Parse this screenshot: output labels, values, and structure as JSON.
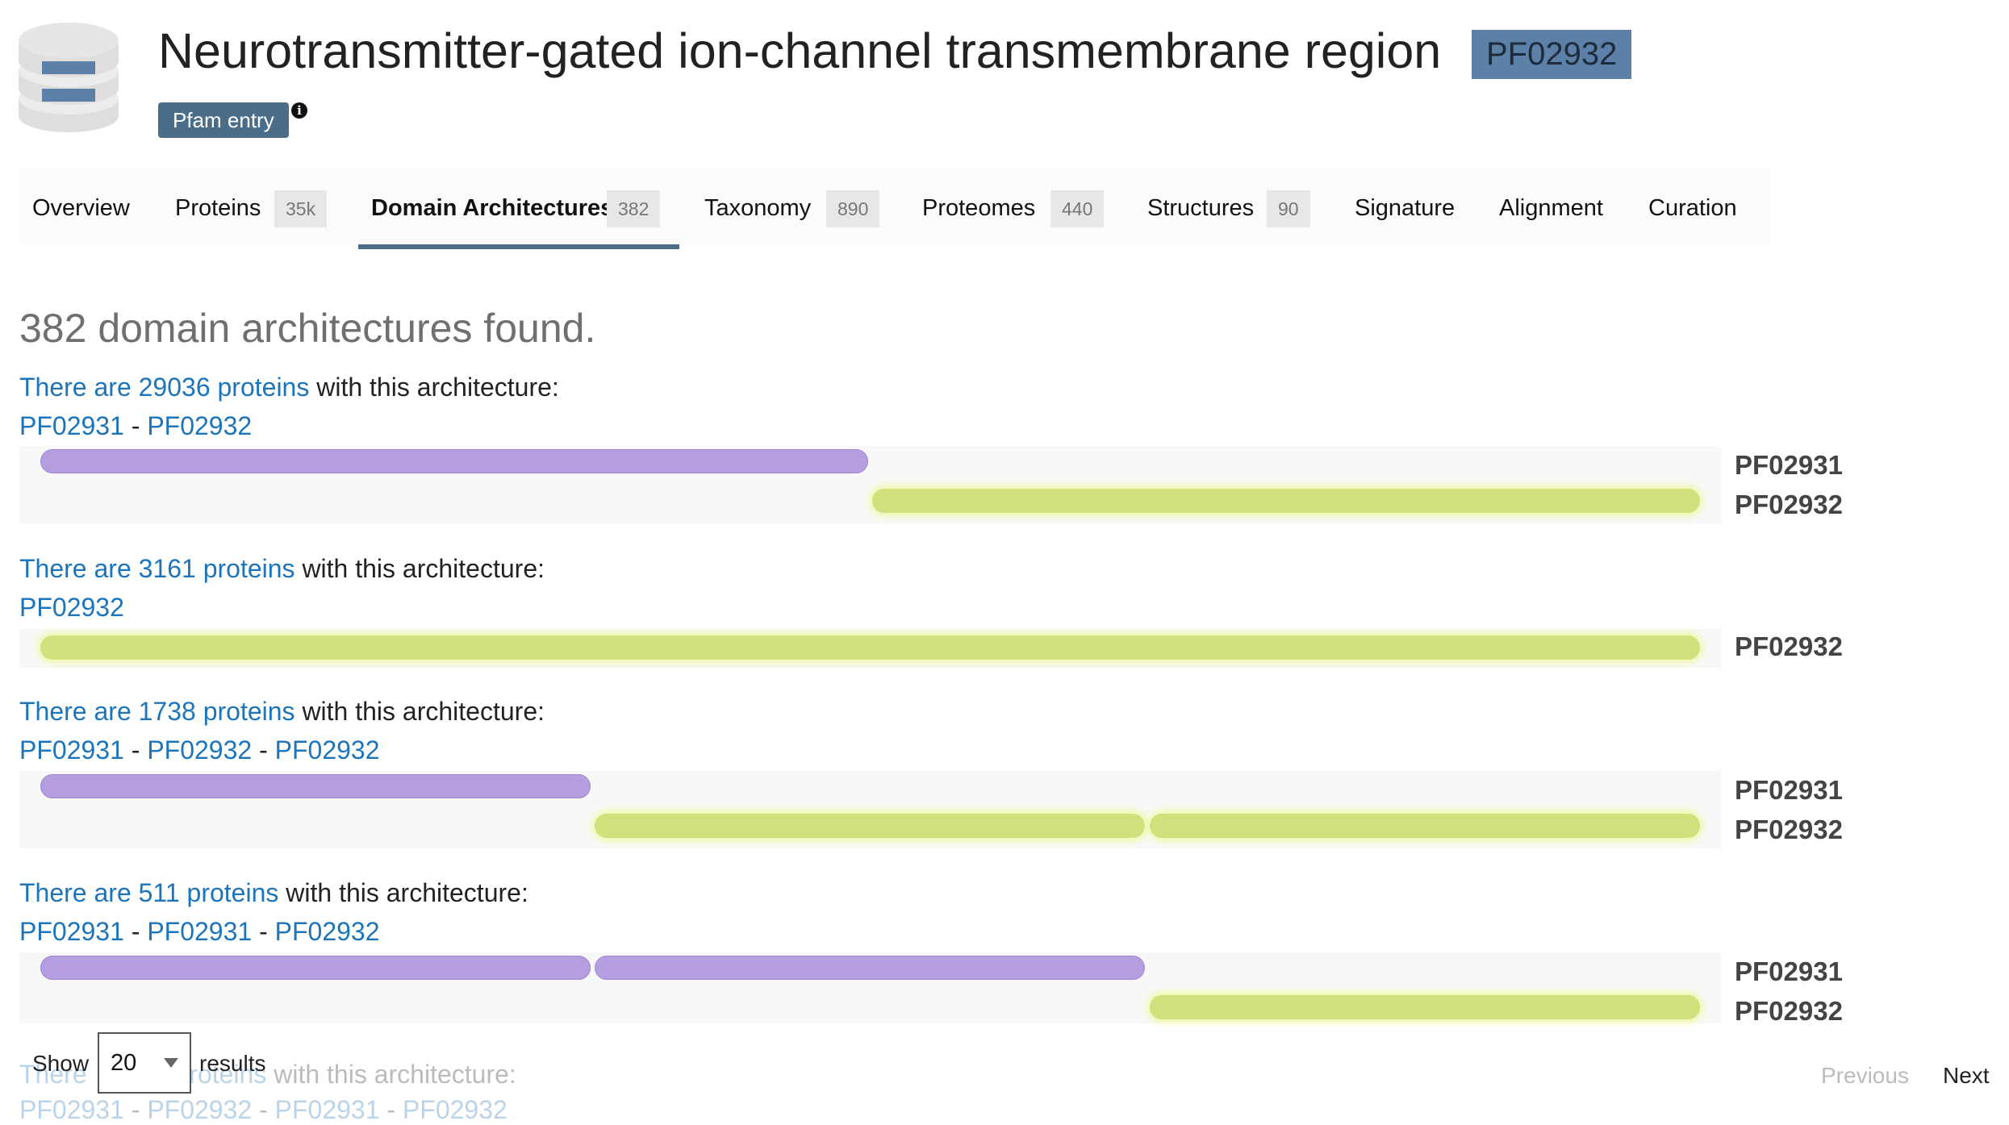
{
  "entry": {
    "title": "Neurotransmitter-gated ion-channel transmembrane region",
    "accession": "PF02932",
    "type_badge": "Pfam entry",
    "info_icon": "i"
  },
  "colors": {
    "accent": "#4a6e8a",
    "accession_badge": "#5d80a8",
    "link": "#1c74bb",
    "domain_PF02931": "#b49ee0",
    "domain_PF02932": "#cfe07c"
  },
  "tabs": [
    {
      "label": "Overview",
      "count": ""
    },
    {
      "label": "Proteins",
      "count": "35k"
    },
    {
      "label": "Domain Architectures",
      "count": "382"
    },
    {
      "label": "Taxonomy",
      "count": "890"
    },
    {
      "label": "Proteomes",
      "count": "440"
    },
    {
      "label": "Structures",
      "count": "90"
    },
    {
      "label": "Signature",
      "count": ""
    },
    {
      "label": "Alignment",
      "count": ""
    },
    {
      "label": "Curation",
      "count": ""
    }
  ],
  "active_tab": "Domain Architectures",
  "results_heading": "382 domain architectures found.",
  "architectures": [
    {
      "prefix": "There are ",
      "count_link": "29036 proteins",
      "suffix": " with this architecture:",
      "domains": [
        "PF02931",
        "PF02932"
      ],
      "legend": [
        "PF02931",
        "PF02932"
      ]
    },
    {
      "prefix": "There are ",
      "count_link": "3161 proteins",
      "suffix": " with this architecture:",
      "domains": [
        "PF02932"
      ],
      "legend": [
        "PF02932"
      ]
    },
    {
      "prefix": "There are ",
      "count_link": "1738 proteins",
      "suffix": " with this architecture:",
      "domains": [
        "PF02931",
        "PF02932",
        "PF02932"
      ],
      "legend": [
        "PF02931",
        "PF02932"
      ]
    },
    {
      "prefix": "There are ",
      "count_link": "511 proteins",
      "suffix": " with this architecture:",
      "domains": [
        "PF02931",
        "PF02931",
        "PF02932"
      ],
      "legend": [
        "PF02931",
        "PF02932"
      ]
    },
    {
      "prefix": "There ",
      "count_link": "proteins",
      "suffix": " with this architecture:",
      "domains": [
        "PF02931",
        "PF02932",
        "PF02931",
        "PF02932"
      ],
      "legend": []
    }
  ],
  "separator": " - ",
  "pagination": {
    "show_label": "Show",
    "page_size": "20",
    "results_label": "results",
    "previous": "Previous",
    "next": "Next"
  },
  "icons": [
    "database-icon",
    "info-icon",
    "chevron-down-icon"
  ]
}
